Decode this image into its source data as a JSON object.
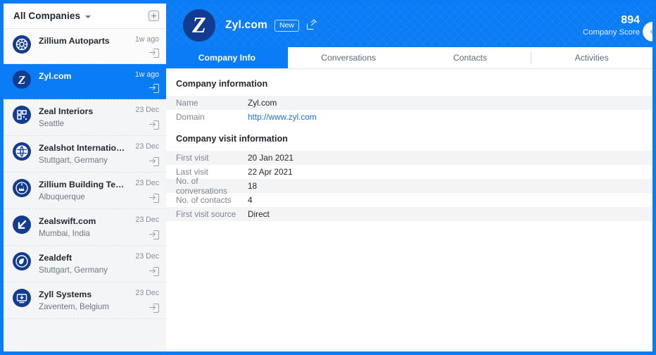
{
  "sidebar": {
    "header": {
      "title": "All Companies",
      "caret_icon": "chevron-down-icon",
      "action_icon": "add-square-icon"
    },
    "items": [
      {
        "name": "Zillium Autoparts",
        "location": "",
        "time": "1w ago",
        "avatar_icon": "globe-gear-icon",
        "row_icon": "login-icon",
        "selected": false,
        "style": "white"
      },
      {
        "name": "Zyl.com",
        "location": "",
        "time": "1w ago",
        "avatar_icon": "letter-z-icon",
        "row_icon": "login-icon",
        "selected": true,
        "style": "selected"
      },
      {
        "name": "Zeal Interiors",
        "location": "Seattle",
        "time": "23 Dec",
        "avatar_icon": "qr-code-icon",
        "row_icon": "login-icon",
        "selected": false,
        "style": "grey"
      },
      {
        "name": "Zealshot International",
        "location": "Stuttgart, Germany",
        "time": "23 Dec",
        "avatar_icon": "globe-icon",
        "row_icon": "login-icon",
        "selected": false,
        "style": "grey"
      },
      {
        "name": "Zillium Building Tech...",
        "location": "Albuquerque",
        "time": "23 Dec",
        "avatar_icon": "factory-icon",
        "row_icon": "login-icon",
        "selected": false,
        "style": "grey"
      },
      {
        "name": "Zealswift.com",
        "location": "Mumbai, India",
        "time": "23 Dec",
        "avatar_icon": "arrow-down-left-icon",
        "row_icon": "login-icon",
        "selected": false,
        "style": "grey"
      },
      {
        "name": "Zealdeft",
        "location": "Stuttgart, Germany",
        "time": "23 Dec",
        "avatar_icon": "leaf-circle-icon",
        "row_icon": "login-icon",
        "selected": false,
        "style": "grey"
      },
      {
        "name": "Zyll Systems",
        "location": "Zaventem, Belgium",
        "time": "23 Dec",
        "avatar_icon": "monitor-icon",
        "row_icon": "login-icon",
        "selected": false,
        "style": "grey"
      }
    ]
  },
  "header": {
    "avatar_letter": "Z",
    "avatar_icon": "letter-z-icon",
    "title": "Zyl.com",
    "badge": "New",
    "external_link_icon": "external-link-icon",
    "score_value": "894",
    "score_label": "Company Score"
  },
  "tabs": [
    {
      "label": "Company Info",
      "active": true,
      "separator_before": false
    },
    {
      "label": "Conversations",
      "active": false,
      "separator_before": false
    },
    {
      "label": "Contacts",
      "active": false,
      "separator_before": false
    },
    {
      "label": "Activities",
      "active": false,
      "separator_before": true
    }
  ],
  "content": {
    "section1_title": "Company information",
    "section1_rows": [
      {
        "key": "Name",
        "value": "Zyl.com",
        "striped": true,
        "link": false
      },
      {
        "key": "Domain",
        "value": "http://www.zyl.com",
        "striped": false,
        "link": true
      }
    ],
    "section2_title": "Company visit information",
    "section2_rows": [
      {
        "key": "First visit",
        "value": "20 Jan 2021",
        "striped": true,
        "link": false
      },
      {
        "key": "Last visit",
        "value": "22 Apr 2021",
        "striped": false,
        "link": false
      },
      {
        "key": "No. of conversations",
        "value": "18",
        "striped": true,
        "link": false
      },
      {
        "key": "No. of contacts",
        "value": "4",
        "striped": false,
        "link": false
      },
      {
        "key": "First visit source",
        "value": "Direct",
        "striped": true,
        "link": false
      }
    ]
  },
  "collapse": {
    "icon": "chevron-left-icon"
  },
  "colors": {
    "accent": "#0a7cf5",
    "avatar_navy": "#133b8f",
    "link": "#1874e8",
    "stripe": "#f3f4f6"
  }
}
